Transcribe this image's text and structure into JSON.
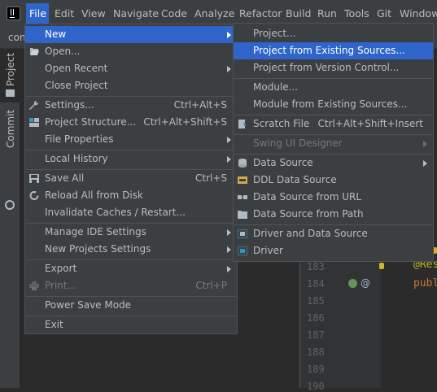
{
  "menubar": {
    "items": [
      "File",
      "Edit",
      "View",
      "Navigate",
      "Code",
      "Analyze",
      "Refactor",
      "Build",
      "Run",
      "Tools",
      "Git",
      "Window"
    ]
  },
  "toolbar": {
    "crumb": "con"
  },
  "tool_strip": {
    "project_label": "Project",
    "commit_label": "Commit"
  },
  "file_menu": {
    "items": [
      {
        "label": "New",
        "shortcut": "",
        "submenu": true
      },
      {
        "label": "Open...",
        "shortcut": "",
        "submenu": false
      },
      {
        "label": "Open Recent",
        "shortcut": "",
        "submenu": true
      },
      {
        "label": "Close Project",
        "shortcut": "",
        "submenu": false
      },
      {
        "label": "Settings...",
        "shortcut": "Ctrl+Alt+S",
        "submenu": false
      },
      {
        "label": "Project Structure...",
        "shortcut": "Ctrl+Alt+Shift+S",
        "submenu": false
      },
      {
        "label": "File Properties",
        "shortcut": "",
        "submenu": true
      },
      {
        "label": "Local History",
        "shortcut": "",
        "submenu": true
      },
      {
        "label": "Save All",
        "shortcut": "Ctrl+S",
        "submenu": false
      },
      {
        "label": "Reload All from Disk",
        "shortcut": "",
        "submenu": false
      },
      {
        "label": "Invalidate Caches / Restart...",
        "shortcut": "",
        "submenu": false
      },
      {
        "label": "Manage IDE Settings",
        "shortcut": "",
        "submenu": true
      },
      {
        "label": "New Projects Settings",
        "shortcut": "",
        "submenu": true
      },
      {
        "label": "Export",
        "shortcut": "",
        "submenu": true
      },
      {
        "label": "Print...",
        "shortcut": "Ctrl+P",
        "submenu": false
      },
      {
        "label": "Power Save Mode",
        "shortcut": "",
        "submenu": false
      },
      {
        "label": "Exit",
        "shortcut": "",
        "submenu": false
      }
    ]
  },
  "new_menu": {
    "items": [
      {
        "label": "Project...",
        "shortcut": ""
      },
      {
        "label": "Project from Existing Sources...",
        "shortcut": ""
      },
      {
        "label": "Project from Version Control...",
        "shortcut": ""
      },
      {
        "label": "Module...",
        "shortcut": ""
      },
      {
        "label": "Module from Existing Sources...",
        "shortcut": ""
      },
      {
        "label": "Scratch File",
        "shortcut": "Ctrl+Alt+Shift+Insert"
      },
      {
        "label": "Swing UI Designer",
        "shortcut": ""
      },
      {
        "label": "Data Source",
        "shortcut": ""
      },
      {
        "label": "DDL Data Source",
        "shortcut": ""
      },
      {
        "label": "Data Source from URL",
        "shortcut": ""
      },
      {
        "label": "Data Source from Path",
        "shortcut": ""
      },
      {
        "label": "Driver and Data Source",
        "shortcut": ""
      },
      {
        "label": "Driver",
        "shortcut": ""
      }
    ]
  },
  "editor": {
    "line_numbers": [
      "183",
      "184",
      "185",
      "186",
      "187",
      "188",
      "189",
      "190"
    ],
    "code_annotation": "@Res",
    "code_public": "publ",
    "gutter_at": "@"
  },
  "colors": {
    "selection": "#2f65ca",
    "menu_bg": "#3c3f41",
    "editor_bg": "#2b2b2b"
  }
}
